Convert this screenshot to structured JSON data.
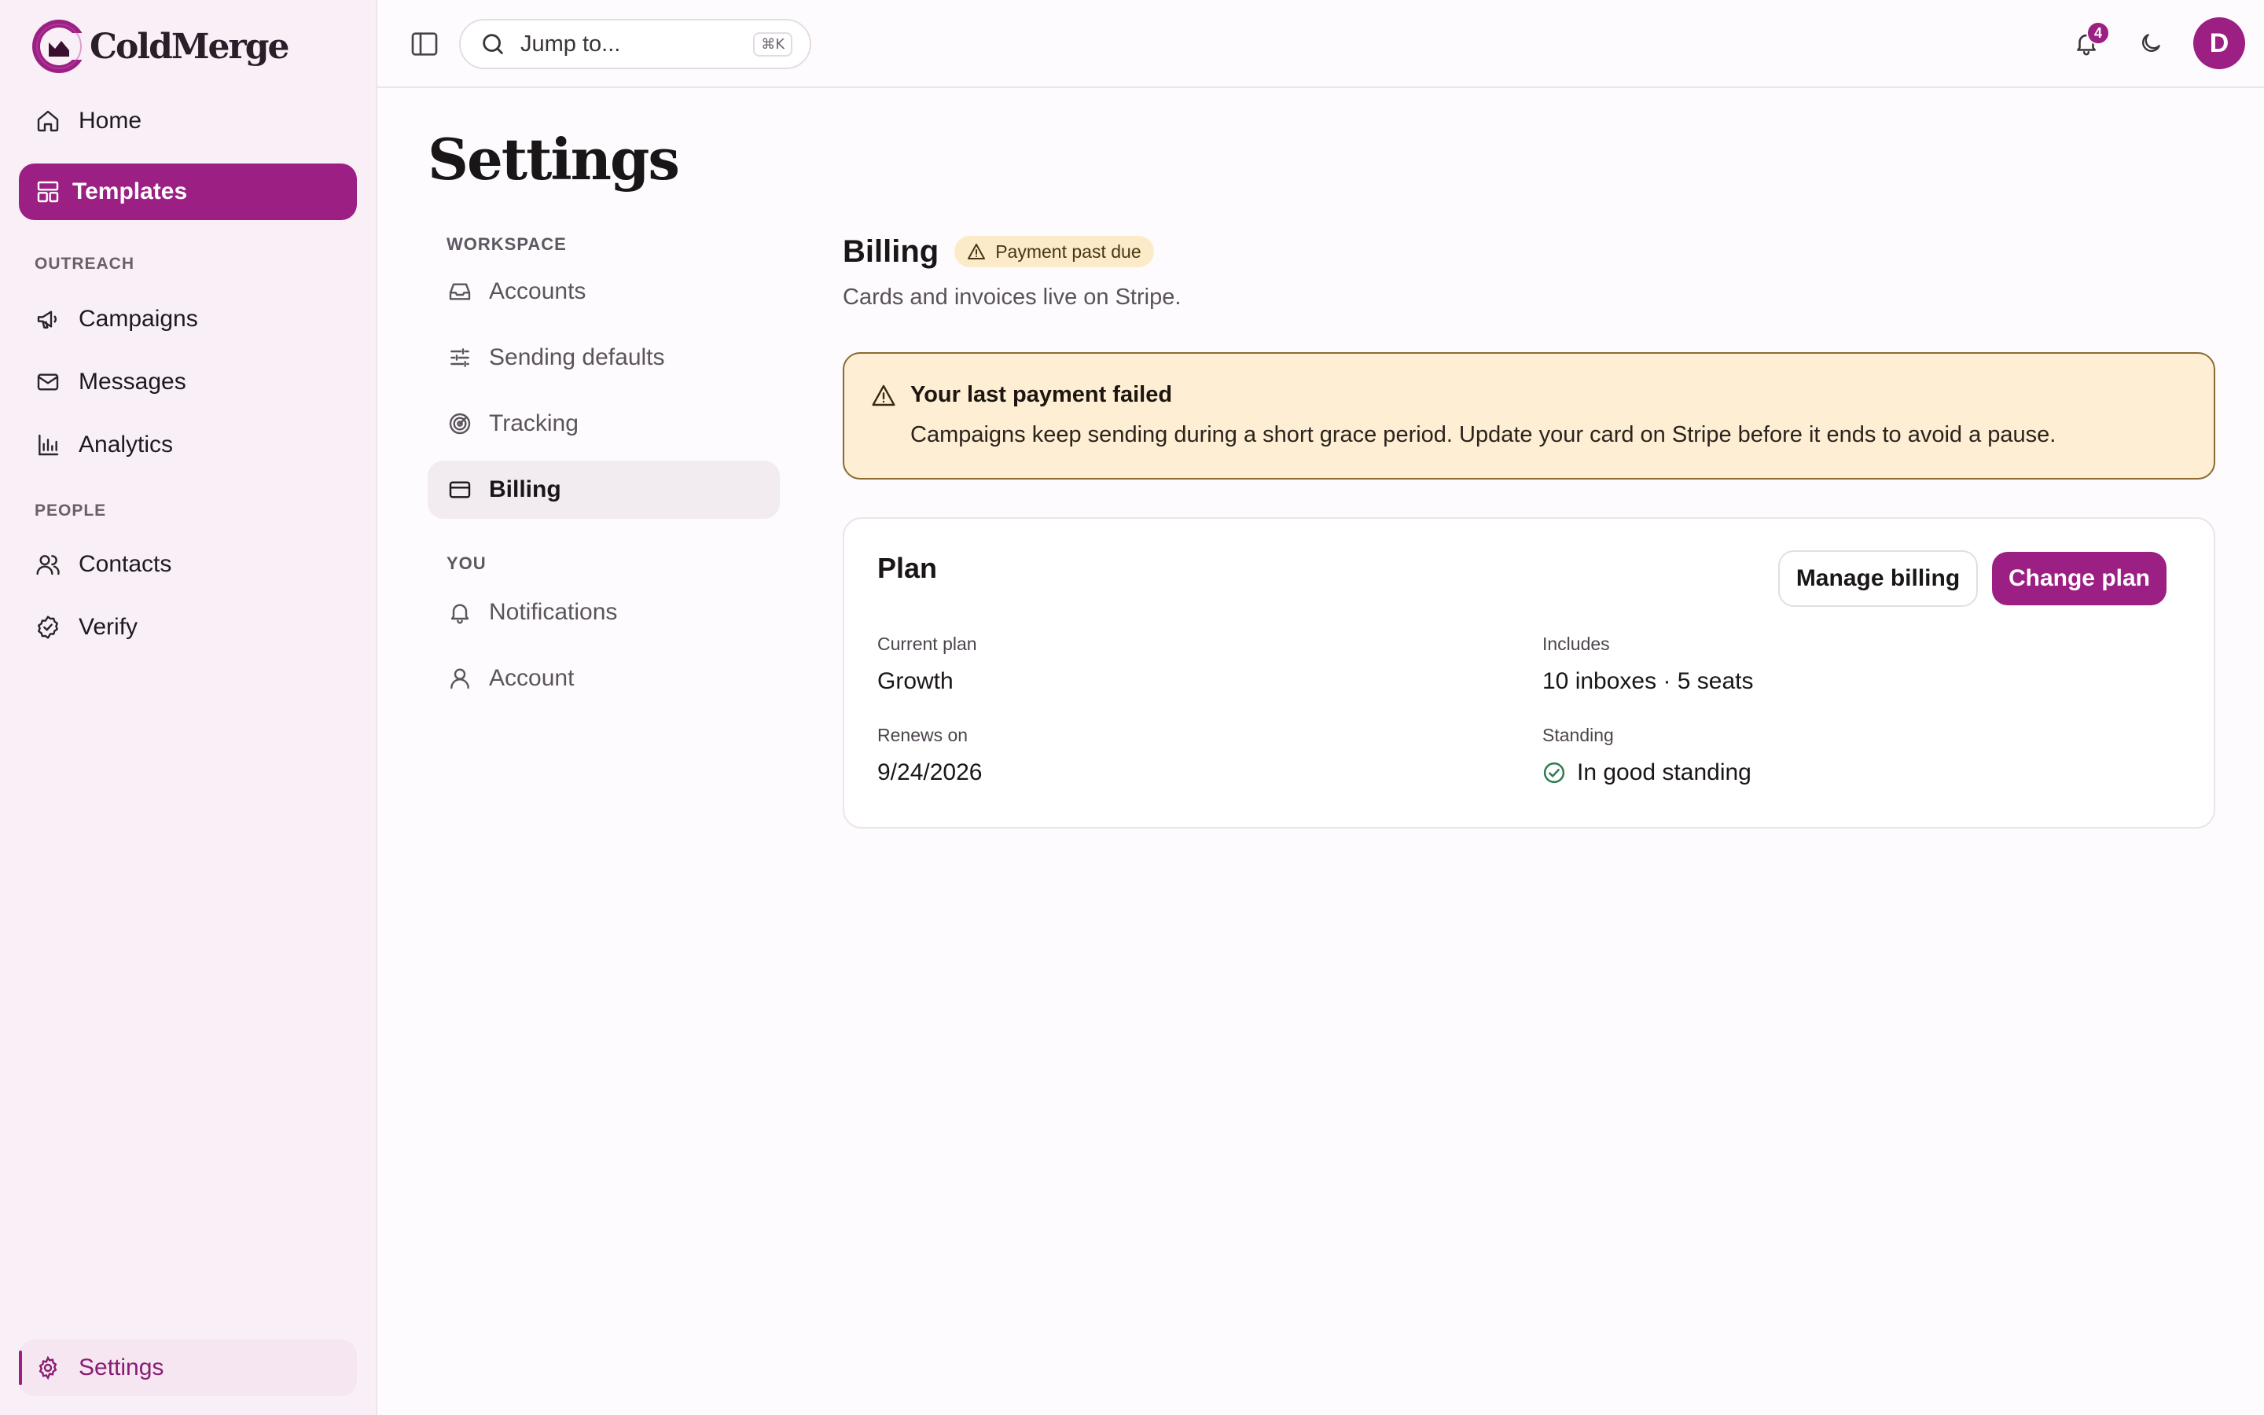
{
  "brand": {
    "name": "ColdMerge"
  },
  "sidebar": {
    "home": "Home",
    "templates": "Templates",
    "groups": {
      "outreach": "OUTREACH",
      "people": "PEOPLE"
    },
    "outreach_items": [
      "Campaigns",
      "Messages",
      "Analytics"
    ],
    "people_items": [
      "Contacts",
      "Verify"
    ],
    "settings": "Settings"
  },
  "topbar": {
    "search_placeholder": "Jump to...",
    "search_shortcut": "⌘K",
    "notification_count": "4",
    "avatar_initial": "D"
  },
  "page": {
    "title": "Settings"
  },
  "subnav": {
    "workspace_label": "WORKSPACE",
    "workspace_items": [
      "Accounts",
      "Sending defaults",
      "Tracking",
      "Billing"
    ],
    "you_label": "YOU",
    "you_items": [
      "Notifications",
      "Account"
    ],
    "active": "Billing"
  },
  "billing": {
    "title": "Billing",
    "status_pill": "Payment past due",
    "subtitle": "Cards and invoices live on Stripe.",
    "alert": {
      "title": "Your last payment failed",
      "body": "Campaigns keep sending during a short grace period. Update your card on Stripe before it ends to avoid a pause."
    },
    "plan": {
      "title": "Plan",
      "manage_button": "Manage billing",
      "change_button": "Change plan",
      "current_plan_label": "Current plan",
      "current_plan_value": "Growth",
      "includes_label": "Includes",
      "includes_value": "10 inboxes · 5 seats",
      "renews_label": "Renews on",
      "renews_value": "9/24/2026",
      "standing_label": "Standing",
      "standing_value": "In good standing"
    }
  },
  "colors": {
    "accent": "#9c1f83",
    "sidebar_bg": "#f8f0f6",
    "warning_bg": "#fdeed4",
    "warning_border": "#8a6a32",
    "success": "#2f7a4f"
  }
}
